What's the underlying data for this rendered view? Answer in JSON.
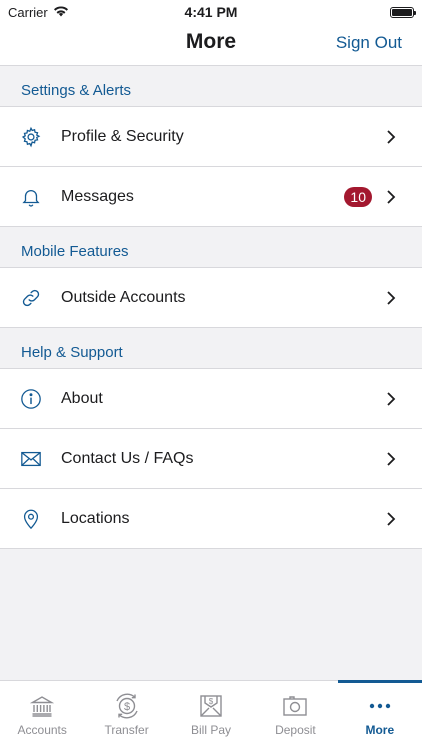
{
  "status": {
    "carrier": "Carrier",
    "time": "4:41 PM"
  },
  "nav": {
    "title": "More",
    "sign_out": "Sign Out"
  },
  "sections": [
    {
      "header": "Settings & Alerts",
      "items": [
        {
          "label": "Profile & Security",
          "icon": "gear-icon"
        },
        {
          "label": "Messages",
          "icon": "bell-icon",
          "badge": "10"
        }
      ]
    },
    {
      "header": "Mobile Features",
      "items": [
        {
          "label": "Outside Accounts",
          "icon": "link-icon"
        }
      ]
    },
    {
      "header": "Help & Support",
      "items": [
        {
          "label": "About",
          "icon": "info-icon"
        },
        {
          "label": "Contact Us / FAQs",
          "icon": "envelope-icon"
        },
        {
          "label": "Locations",
          "icon": "location-pin-icon"
        }
      ]
    }
  ],
  "tabs": [
    {
      "label": "Accounts",
      "icon": "bank-icon",
      "active": false
    },
    {
      "label": "Transfer",
      "icon": "transfer-icon",
      "active": false
    },
    {
      "label": "Bill Pay",
      "icon": "bill-pay-icon",
      "active": false
    },
    {
      "label": "Deposit",
      "icon": "camera-icon",
      "active": false
    },
    {
      "label": "More",
      "icon": "ellipsis-icon",
      "active": true
    }
  ],
  "colors": {
    "accent": "#135a93",
    "badge": "#a3182f",
    "background": "#f2f2f4",
    "divider": "#d8d8dc"
  }
}
